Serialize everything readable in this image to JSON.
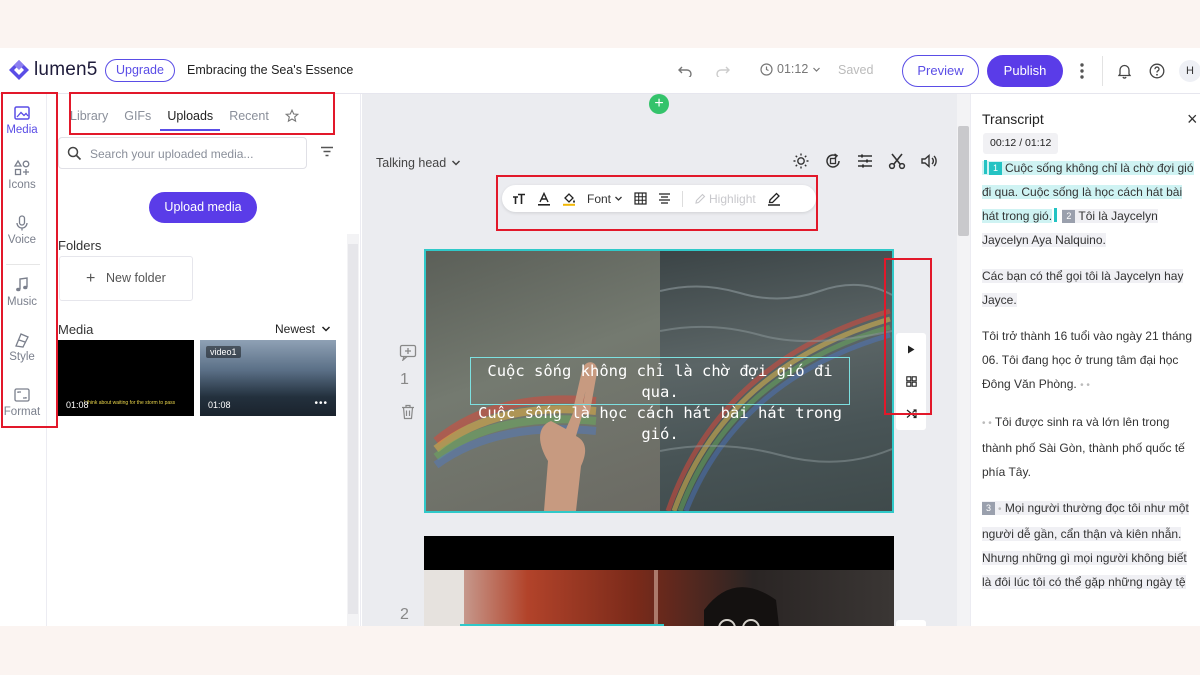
{
  "header": {
    "logo_text": "lumen5",
    "upgrade_label": "Upgrade",
    "project_title": "Embracing the Sea's Essence",
    "timer": "01:12",
    "saved_label": "Saved",
    "preview_label": "Preview",
    "publish_label": "Publish",
    "avatar_initial": "H"
  },
  "rail": {
    "items": [
      {
        "label": "Media",
        "icon": "image-icon",
        "active": true
      },
      {
        "label": "Icons",
        "icon": "shapes-icon"
      },
      {
        "label": "Voice",
        "icon": "microphone-icon"
      },
      {
        "label": "Music",
        "icon": "music-note-icon"
      },
      {
        "label": "Style",
        "icon": "style-icon"
      },
      {
        "label": "Format",
        "icon": "format-icon"
      }
    ]
  },
  "panel": {
    "tabs": [
      {
        "label": "Library"
      },
      {
        "label": "GIFs"
      },
      {
        "label": "Uploads",
        "active": true
      },
      {
        "label": "Recent"
      }
    ],
    "search_placeholder": "Search your uploaded media...",
    "upload_label": "Upload media",
    "folders_label": "Folders",
    "new_folder_label": "New folder",
    "media_label": "Media",
    "sort_label": "Newest",
    "media_items": [
      {
        "duration": "01:08",
        "caption": "I think about waiting for the storm to pass"
      },
      {
        "tag": "video1",
        "duration": "01:08"
      }
    ]
  },
  "canvas": {
    "layout_label": "Talking head",
    "toolbar": {
      "font_label": "Font",
      "highlight_label": "Highlight"
    },
    "scenes": [
      {
        "number": "1",
        "caption_line1": "Cuộc sống không chỉ là chờ đợi gió đi qua.",
        "caption_line2": "Cuộc sống là học cách hát bài hát trong gió."
      },
      {
        "number": "2"
      }
    ]
  },
  "transcript": {
    "title": "Transcript",
    "time": "00:12 / 01:12",
    "p1_badge": "1",
    "p1_text": "Cuộc sống không chỉ là chờ đợi gió đi qua. Cuộc sống là học cách hát bài hát trong gió.",
    "p1_badge2": "2",
    "p1_text2": "Tôi là Jaycelyn Jaycelyn Aya Nalquino.",
    "p2": "Các bạn có thể gọi tôi là Jaycelyn hay Jayce.",
    "p3": "Tôi trở thành 16 tuổi vào ngày 21 tháng 06. Tôi đang học ở trung tâm đại học Đông Văn Phòng.",
    "p4": "Tôi được sinh ra và lớn lên trong thành phố Sài Gòn, thành phố quốc tế phía Tây.",
    "p5_badge": "3",
    "p5": "Mọi người thường đọc tôi như một người dễ gần, cẩn thận và kiên nhẫn. Nhưng những gì mọi người không biết là đôi lúc tôi có thể gặp những ngày tệ"
  },
  "colors": {
    "accent": "#5a3ce8",
    "highlight_box": "#e2182a",
    "scene_border": "#30c9c9",
    "add_button": "#34c36b"
  }
}
